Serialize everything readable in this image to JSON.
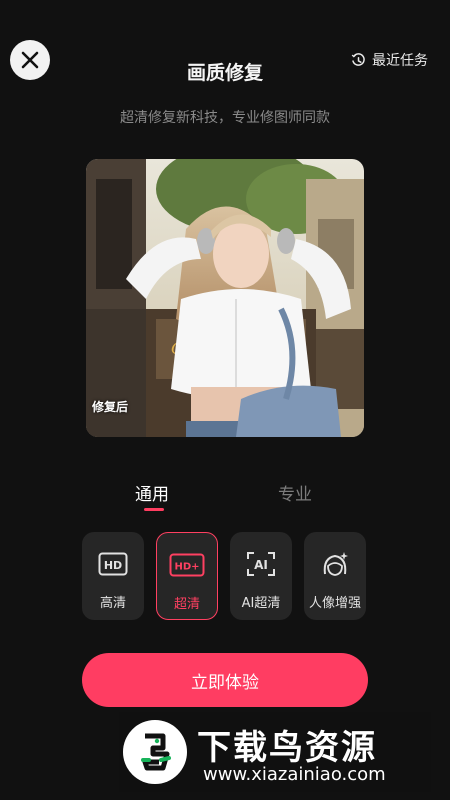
{
  "header": {
    "title": "画质修复",
    "recent_tasks": "最近任务",
    "subtitle": "超清修复新科技，专业修图师同款"
  },
  "preview": {
    "label": "修复后",
    "sign_text": "Cin"
  },
  "tabs": [
    {
      "label": "通用",
      "active": true
    },
    {
      "label": "专业",
      "active": false
    }
  ],
  "modes": [
    {
      "label": "高清",
      "icon": "hd-icon",
      "badge": "HD"
    },
    {
      "label": "超清",
      "icon": "hd-plus-icon",
      "badge": "HD+",
      "selected": true
    },
    {
      "label": "AI超清",
      "icon": "ai-icon",
      "badge": "AI"
    },
    {
      "label": "人像增强",
      "icon": "portrait-enhance-icon"
    }
  ],
  "cta": {
    "label": "立即体验"
  },
  "watermark": {
    "title": "下载鸟资源",
    "url": "www.xiazainiao.com"
  },
  "colors": {
    "accent": "#ff3d62",
    "background": "#111111",
    "card": "#262626"
  }
}
